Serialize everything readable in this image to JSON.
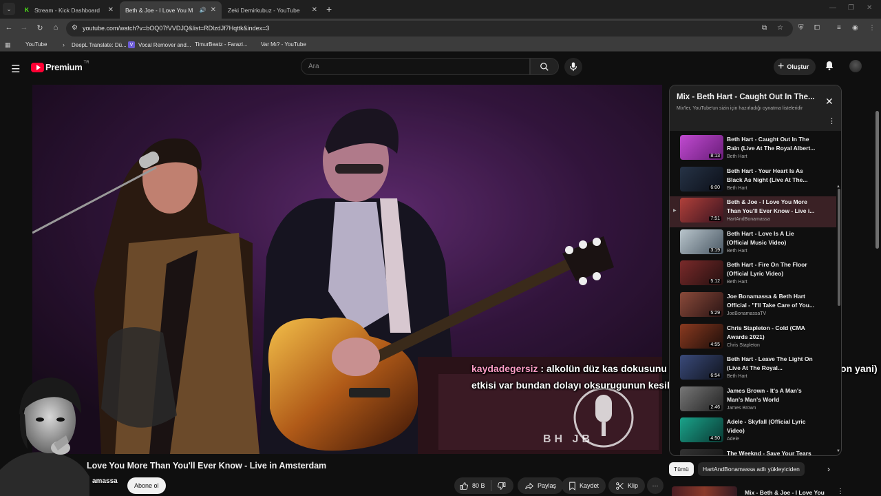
{
  "browser": {
    "tabs": [
      {
        "label": "Stream - Kick Dashboard",
        "favicon": "kick-icon",
        "active": false
      },
      {
        "label": "Beth & Joe - I Love You M",
        "favicon": "youtube-icon",
        "active": true
      },
      {
        "label": "Zeki Demirkubuz - YouTube",
        "favicon": "youtube-icon",
        "active": false
      }
    ],
    "address": "youtube.com/watch?v=bOQ07fVVDJQ&list=RDlzdJf7Hqttk&index=3",
    "bookmarks": [
      {
        "label": "YouTube",
        "favicon": "youtube-icon"
      },
      {
        "label": "DeepL Translate: Dü...",
        "favicon": "deepl-icon"
      },
      {
        "label": "Vocal Remover and...",
        "favicon": "vocalremover-icon"
      },
      {
        "label": "TimurBeatz - Farazi...",
        "favicon": "youtube-icon"
      },
      {
        "label": "Var Mı? - YouTube",
        "favicon": "youtube-icon"
      }
    ]
  },
  "header": {
    "logo_text": "Premium",
    "logo_country": "TR",
    "search_placeholder": "Ara",
    "create_label": "Oluştur"
  },
  "video": {
    "title_fragment": "Love You More Than You'll Ever Know - Live in Amsterdam",
    "channel_fragment": "amassa",
    "subscribe_label": "Abone ol",
    "watermark": "BH JB",
    "actions": {
      "likes": "80 B",
      "share": "Paylaş",
      "save": "Kaydet",
      "clip": "Klip"
    }
  },
  "chat_overlay": {
    "user": "kaydadegersiz",
    "message": ": alkolün düz kas dokusunu genisletme(az da olsa bronkodilatasyon yani) etkisi var bundan dolayı oksurugunun kesildigini hissediyir olabilirsin"
  },
  "playlist": {
    "title": "Mix - Beth Hart - Caught Out In The...",
    "subtitle": "Mix'ler, YouTube'un sizin için hazırladığı oynatma listeleridir",
    "items": [
      {
        "title": "Beth Hart - Caught Out In The Rain (Live At The Royal Albert...",
        "channel": "Beth Hart",
        "duration": "8:13",
        "thumb": [
          "#c04ad0",
          "#6a1d7a"
        ]
      },
      {
        "title": "Beth Hart - Your Heart Is As Black As Night (Live At The...",
        "channel": "Beth Hart",
        "duration": "6:00",
        "thumb": [
          "#263346",
          "#0c0f18"
        ]
      },
      {
        "title": "Beth & Joe - I Love You More Than You'll Ever Know - Live i...",
        "channel": "HartAndBonamassa",
        "duration": "7:51",
        "thumb": [
          "#b0403a",
          "#3b1420"
        ],
        "current": true
      },
      {
        "title": "Beth Hart - Love Is A Lie (Official Music Video)",
        "channel": "Beth Hart",
        "duration": "3:19",
        "thumb": [
          "#b9c5cc",
          "#4a5864"
        ]
      },
      {
        "title": "Beth Hart - Fire On The Floor (Official Lyric Video)",
        "channel": "Beth Hart",
        "duration": "5:12",
        "thumb": [
          "#7a2a2a",
          "#241010"
        ]
      },
      {
        "title": "Joe Bonamassa & Beth Hart Official - \"I'll Take Care of You...",
        "channel": "JoeBonamassaTV",
        "duration": "5:29",
        "thumb": [
          "#8a4a3a",
          "#2a1414"
        ]
      },
      {
        "title": "Chris Stapleton - Cold (CMA Awards 2021)",
        "channel": "Chris Stapleton",
        "duration": "4:55",
        "thumb": [
          "#8a3a20",
          "#1e0e0a"
        ]
      },
      {
        "title": "Beth Hart - Leave The Light On (Live At The Royal...",
        "channel": "Beth Hart",
        "duration": "6:54",
        "thumb": [
          "#3a4a7a",
          "#10141e"
        ]
      },
      {
        "title": "James Brown - It's A Man's Man's Man's World",
        "channel": "James Brown",
        "duration": "2:46",
        "thumb": [
          "#777",
          "#222"
        ]
      },
      {
        "title": "Adele - Skyfall (Official Lyric Video)",
        "channel": "Adele",
        "duration": "4:50",
        "thumb": [
          "#1aa38a",
          "#0a3a34"
        ]
      },
      {
        "title": "The Weeknd - Save Your Tears",
        "channel": "",
        "duration": "",
        "thumb": [
          "#333",
          "#111"
        ]
      }
    ]
  },
  "chips": {
    "all": "Tümü",
    "uploads": "HartAndBonamassa adlı yükleyiciden"
  },
  "recommendation": {
    "title": "Mix - Beth & Joe - I Love You"
  },
  "colors": {
    "accent": "#ff0033",
    "chat_user": "#ff9ec7",
    "current_item_bg": "#3a2125"
  }
}
